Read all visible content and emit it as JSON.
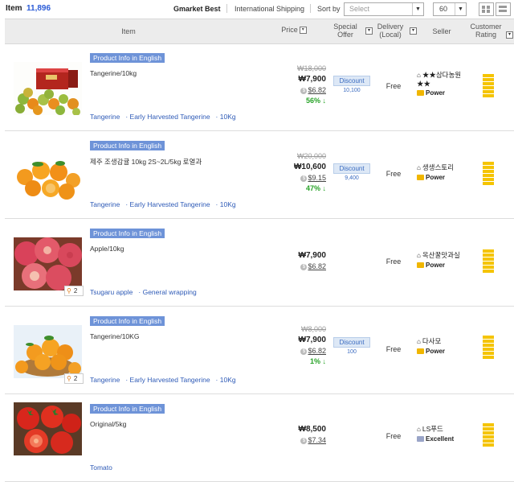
{
  "topbar": {
    "item_label": "Item",
    "item_count": "11,896",
    "best": "Gmarket Best",
    "intl": "International Shipping",
    "sort_by": "Sort by",
    "select_placeholder": "Select",
    "count": "60"
  },
  "header": {
    "item": "Item",
    "price": "Price",
    "special_offer_1": "Special",
    "special_offer_2": "Offer",
    "delivery_1": "Delivery",
    "delivery_2": "(Local)",
    "seller": "Seller",
    "rating_1": "Customer",
    "rating_2": "Rating"
  },
  "products": [
    {
      "badge": "Product Info in English",
      "title": "Tangerine/10kg",
      "tags": [
        "Tangerine",
        "· Early Harvested Tangerine",
        "· 10Kg"
      ],
      "orig_price": "₩18,000",
      "price": "₩7,900",
      "usd": "$6.82",
      "pct": "56%",
      "discount": "Discount",
      "discount_amt": "10,100",
      "delivery": "Free",
      "seller": "★★삼다농원★★",
      "grade": "Power",
      "zoom": ""
    },
    {
      "badge": "Product Info in English",
      "title": "제주 조생감귤 10kg 2S~2L/5kg 로열과",
      "tags": [
        "Tangerine",
        "· Early Harvested Tangerine",
        "· 10Kg"
      ],
      "orig_price": "₩20,000",
      "price": "₩10,600",
      "usd": "$9.15",
      "pct": "47%",
      "discount": "Discount",
      "discount_amt": "9,400",
      "delivery": "Free",
      "seller": "생생스토리",
      "grade": "Power",
      "zoom": ""
    },
    {
      "badge": "Product Info in English",
      "title": "Apple/10kg",
      "tags": [
        "Tsugaru apple",
        "· General wrapping"
      ],
      "orig_price": "",
      "price": "₩7,900",
      "usd": "$6.82",
      "pct": "",
      "discount": "",
      "discount_amt": "",
      "delivery": "Free",
      "seller": "옥산꿀맛과실",
      "grade": "Power",
      "zoom": "2"
    },
    {
      "badge": "Product Info in English",
      "title": "Tangerine/10KG",
      "tags": [
        "Tangerine",
        "· Early Harvested Tangerine",
        "· 10Kg"
      ],
      "orig_price": "₩8,000",
      "price": "₩7,900",
      "usd": "$6.82",
      "pct": "1%",
      "discount": "Discount",
      "discount_amt": "100",
      "delivery": "Free",
      "seller": "다사모",
      "grade": "Power",
      "zoom": "2"
    },
    {
      "badge": "Product Info in English",
      "title": "Original/5kg",
      "tags": [
        "Tomato"
      ],
      "orig_price": "",
      "price": "₩8,500",
      "usd": "$7.34",
      "pct": "",
      "discount": "",
      "discount_amt": "",
      "delivery": "Free",
      "seller": "LS푸드",
      "grade": "Excellent",
      "zoom": ""
    }
  ]
}
